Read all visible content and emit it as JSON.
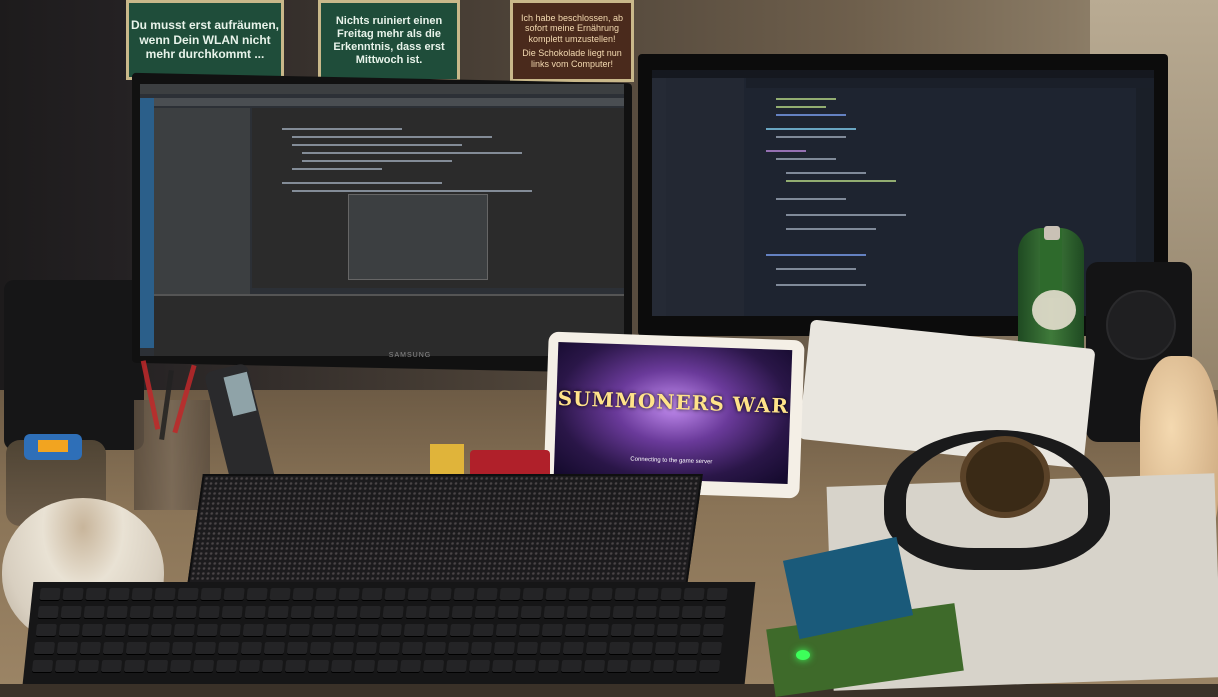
{
  "signs": {
    "sign1": "Du musst erst aufräumen, wenn Dein WLAN nicht mehr durchkommt ...",
    "sign2": "Nichts ruiniert einen Freitag mehr als die Erkenntnis, dass erst Mittwoch ist.",
    "sign3_line1": "Ich habe beschlossen, ab sofort meine Ernährung komplett umzustellen!",
    "sign3_line2": "Die Schokolade liegt nun links vom Computer!"
  },
  "monitor_left": {
    "brand": "SAMSUNG"
  },
  "tablet": {
    "game_title": "SUMMONERS WAR",
    "status": "Connecting to the game server"
  },
  "colors": {
    "sign_green": "#1f4d3a",
    "led_green": "#3dff5a",
    "bottle_green": "#2e6a2c"
  }
}
